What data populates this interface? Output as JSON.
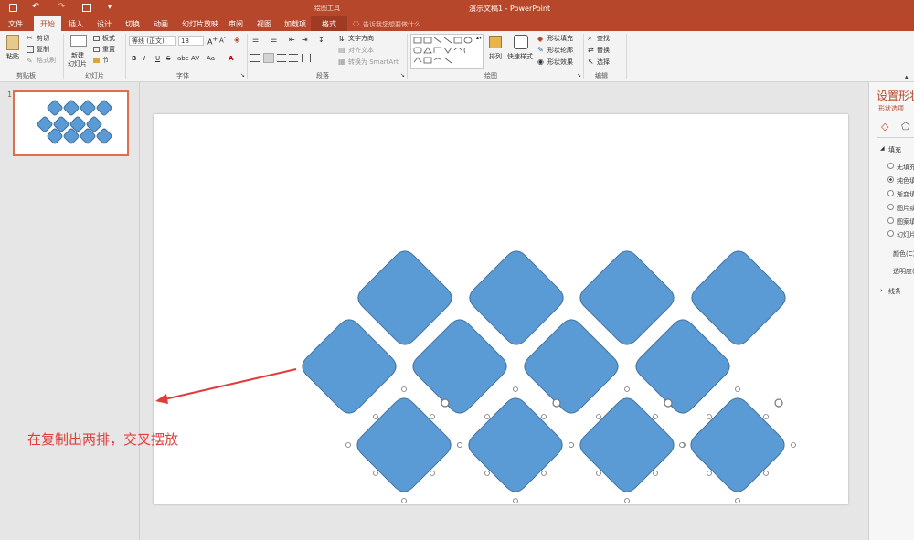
{
  "app": {
    "title": "演示文稿1 - PowerPoint",
    "context_tab_group": "绘图工具",
    "tell_me": "告诉我您想要做什么..."
  },
  "menu": [
    "文件",
    "开始",
    "插入",
    "设计",
    "切换",
    "动画",
    "幻灯片放映",
    "审阅",
    "视图",
    "加载项",
    "格式"
  ],
  "active_menu": "开始",
  "ribbon": {
    "clipboard": {
      "paste": "粘贴",
      "cut": "剪切",
      "copy": "复制",
      "format_painter": "格式刷",
      "group": "剪贴板"
    },
    "slides": {
      "new_slide_line1": "新建",
      "new_slide_line2": "幻灯片",
      "layout": "板式",
      "reset": "重置",
      "section": "节",
      "group": "幻灯片"
    },
    "font": {
      "font_name": "等线 (正文)",
      "font_size": "18",
      "group": "字体",
      "buttons": [
        "B",
        "I",
        "U",
        "S",
        "abc",
        "AV",
        "Aa",
        "A"
      ]
    },
    "paragraph": {
      "text_direction": "文字方向",
      "align_text": "对齐文本",
      "smartart": "转换为 SmartArt",
      "group": "段落"
    },
    "drawing": {
      "arrange": "排列",
      "quick_styles": "快速样式",
      "shape_fill": "形状填充",
      "shape_outline": "形状轮廓",
      "shape_effects": "形状效果",
      "group": "绘图"
    },
    "editing": {
      "find": "查找",
      "replace": "替换",
      "select": "选择",
      "group": "编辑"
    }
  },
  "thumbnail": {
    "number": "1"
  },
  "annotation": {
    "text": "在复制出两排，交叉摆放"
  },
  "format_pane": {
    "title": "设置形状",
    "subtitle": "形状选项",
    "fill_section": "填充",
    "fill_options": [
      "无填充",
      "纯色填",
      "渐变填",
      "图片或",
      "图案填",
      "幻灯片"
    ],
    "color": "颜色(C)",
    "transparency": "透明度(",
    "line_section": "线条"
  },
  "colors": {
    "accent": "#b7472a",
    "shape_fill": "#5b9bd5",
    "shape_stroke": "#41719c",
    "arrow": "#e03c3c"
  }
}
